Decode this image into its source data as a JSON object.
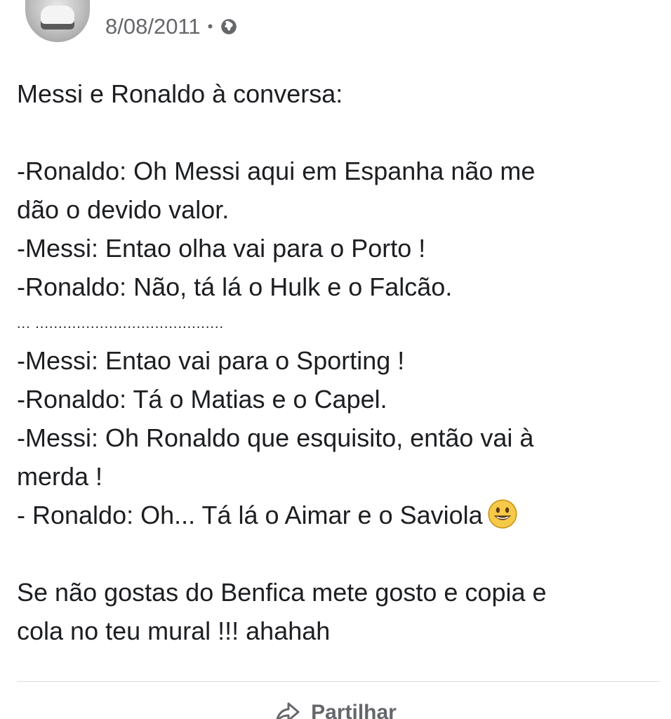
{
  "post": {
    "author_name": "",
    "date": "8/08/2011",
    "separator": "•",
    "privacy_icon": "globe-icon",
    "text": {
      "title_line": "Messi e Ronaldo à conversa:",
      "lines": [
        "-Ronaldo: Oh Messi aqui em Espanha não me",
        "dão o devido valor.",
        "-Messi: Entao olha vai para o Porto !",
        "-Ronaldo: Não, tá lá o Hulk e o Falcão.",
        "... .........................................",
        "-Messi: Entao vai para o Sporting !",
        "-Ronaldo: Tá o Matias e o Capel.",
        "-Messi: Oh Ronaldo que esquisito, então vai à",
        "merda !",
        "- Ronaldo: Oh... Tá lá o Aimar e o Saviola"
      ],
      "closing_lines": [
        "Se não gostas do Benfica mete gosto e copia e",
        "cola no teu mural !!! ahahah"
      ],
      "emoji": "smiling-face-emoji"
    }
  },
  "actions": {
    "share_label": "Partilhar",
    "share_icon": "share-icon"
  },
  "colors": {
    "text": "#1c1e21",
    "meta": "#65676b",
    "divider": "#dadde1",
    "emoji_fill": "#f7c948"
  }
}
